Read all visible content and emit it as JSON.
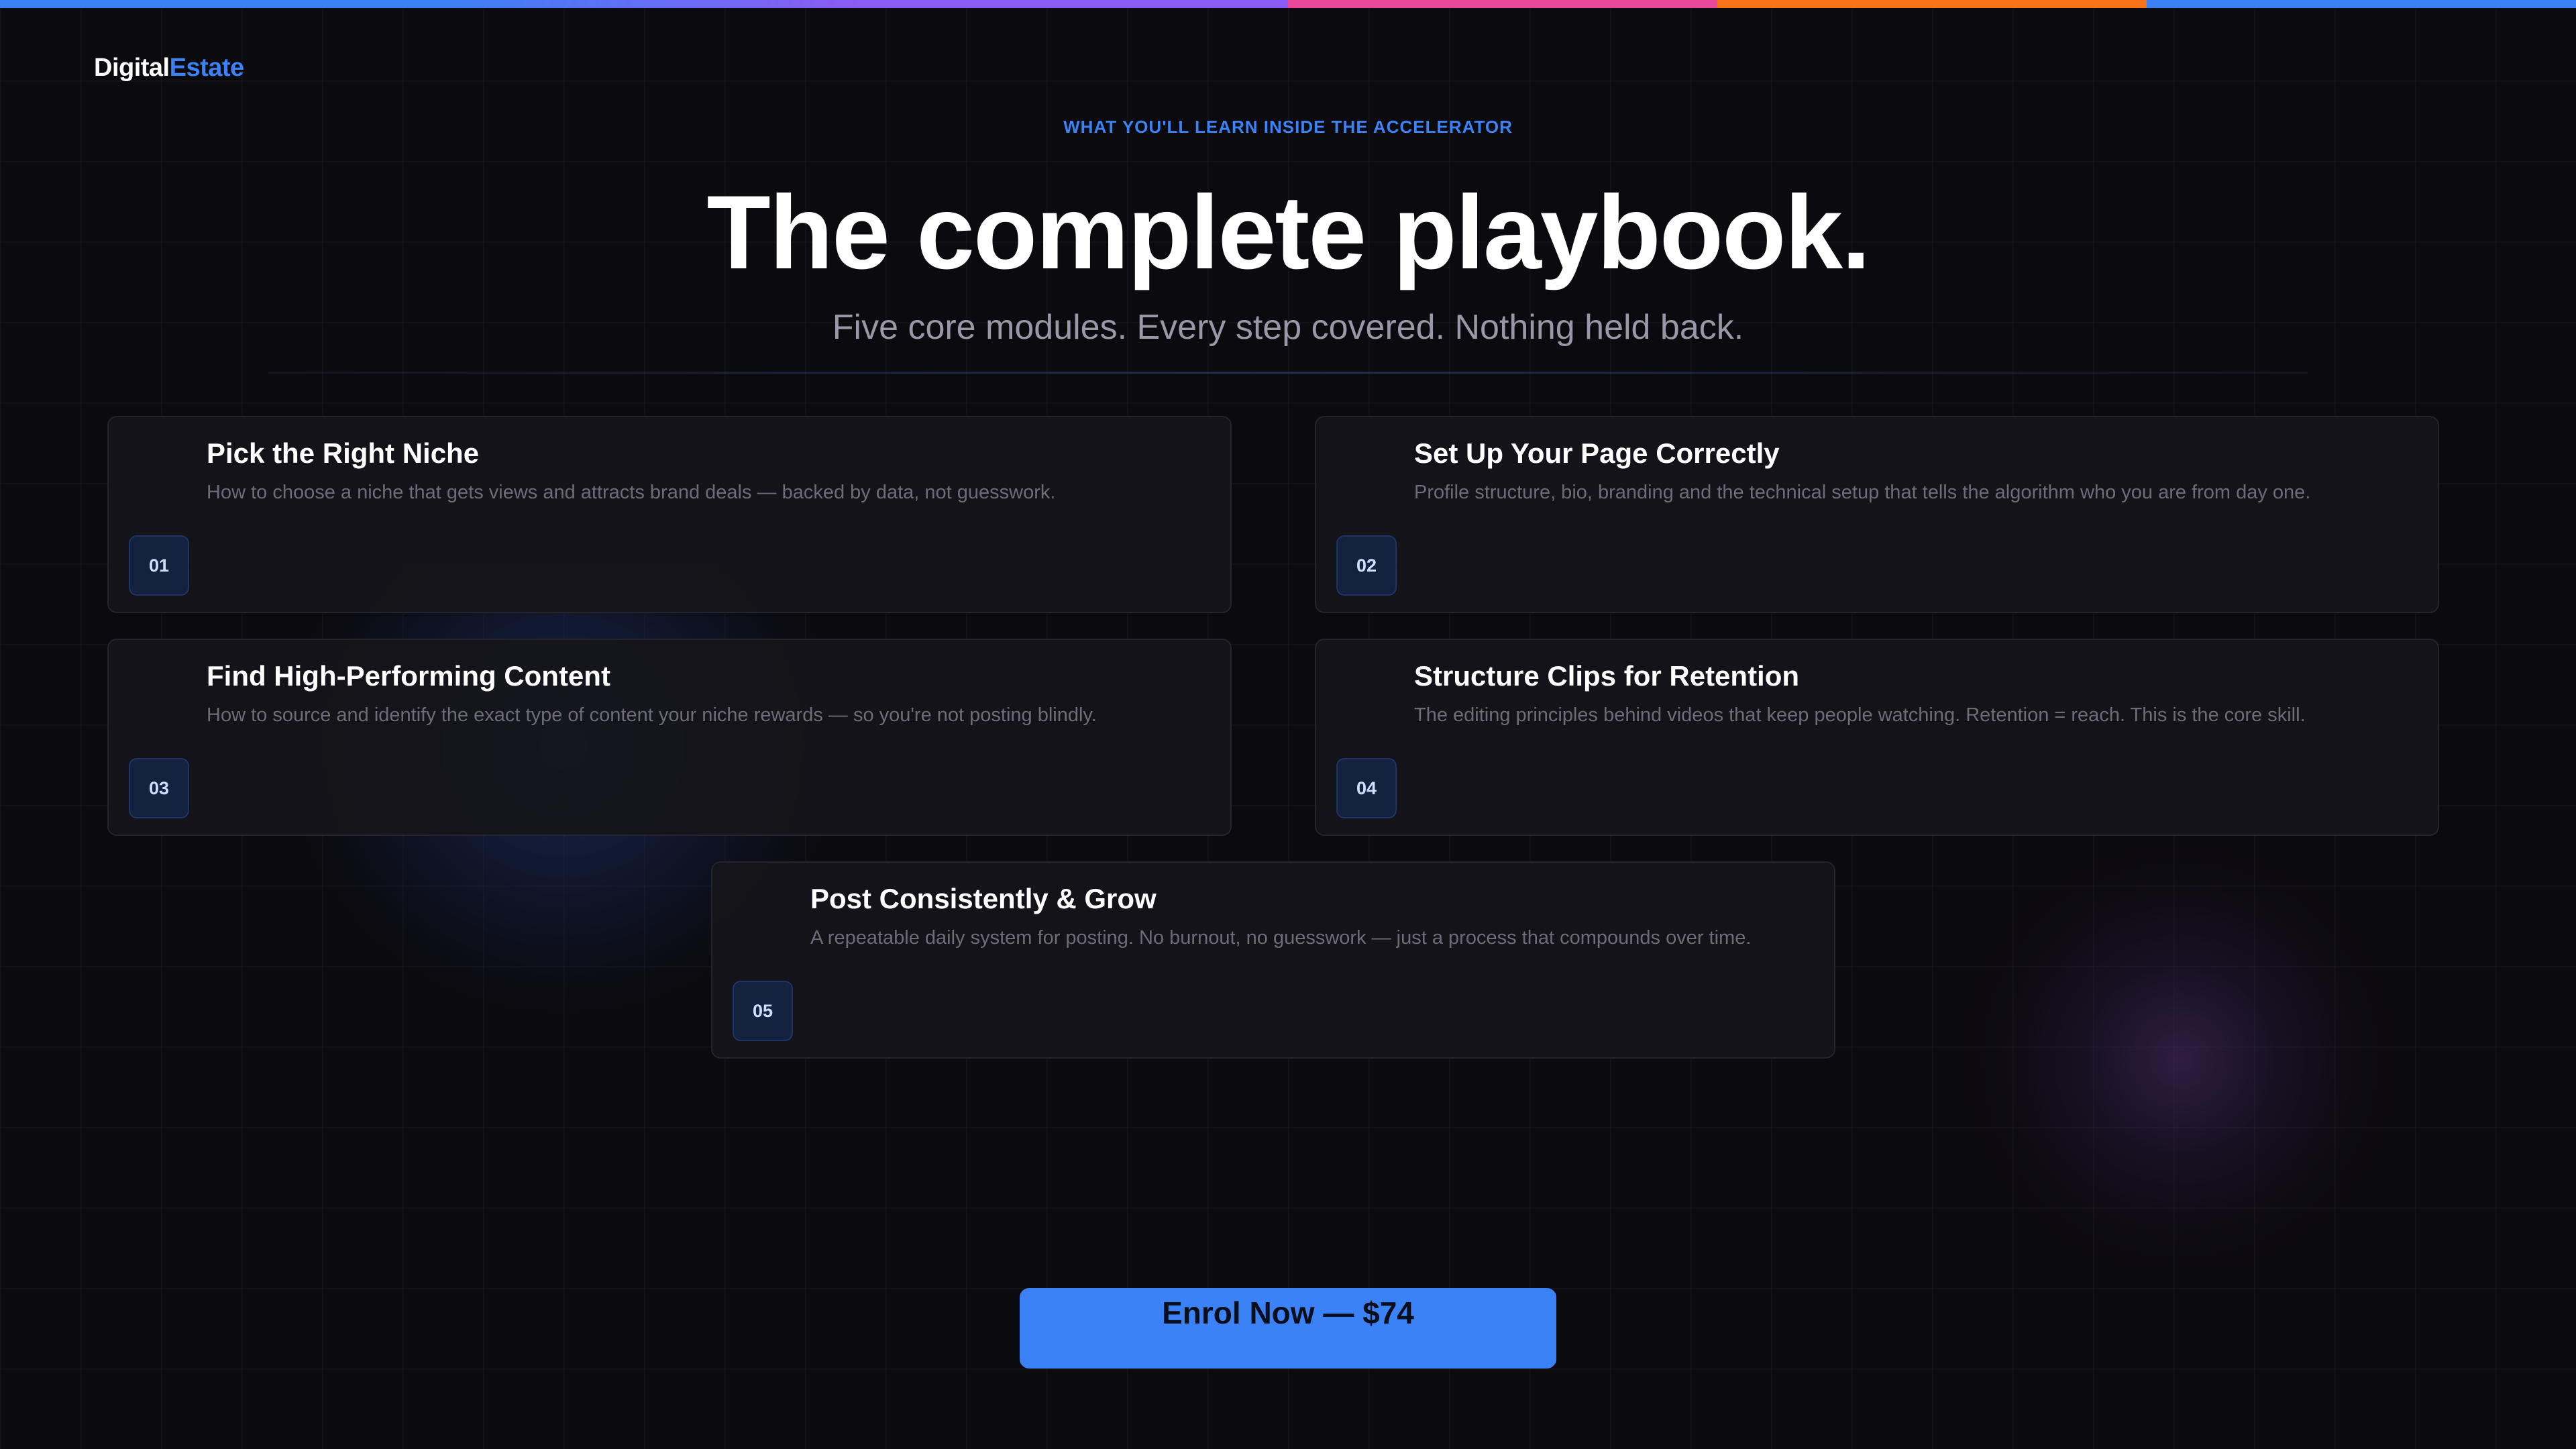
{
  "brand": {
    "logo_part1": "Digital",
    "logo_part2": "Estate",
    "logo_part1_color": "#ffffff",
    "logo_part2_color": "#3b82f6"
  },
  "topbar_colors": [
    "#3b82f6",
    "#8b5cf6",
    "#ec4899",
    "#f97316",
    "#3b82f6"
  ],
  "hero": {
    "eyebrow": "WHAT YOU'LL LEARN INSIDE THE ACCELERATOR",
    "title": "The complete playbook.",
    "subtitle": "Five core modules. Every step covered. Nothing held back."
  },
  "modules": [
    {
      "number": "01",
      "title": "Pick the Right Niche",
      "description": "How to choose a niche that gets views and attracts brand deals — backed by data, not guesswork."
    },
    {
      "number": "02",
      "title": "Set Up Your Page Correctly",
      "description": "Profile structure, bio, branding and the technical setup that tells the algorithm who you are from day one."
    },
    {
      "number": "03",
      "title": "Find High-Performing Content",
      "description": "How to source and identify the exact type of content your niche rewards — so you're not posting blindly."
    },
    {
      "number": "04",
      "title": "Structure Clips for Retention",
      "description": "The editing principles behind videos that keep people watching. Retention = reach. This is the core skill."
    },
    {
      "number": "05",
      "title": "Post Consistently & Grow",
      "description": "A repeatable daily system for posting. No burnout, no guesswork — just a process that compounds over time."
    }
  ],
  "cta": {
    "label": "Enrol Now — $74",
    "color": "#3b82f6"
  },
  "colors": {
    "background": "#0b0a0e",
    "accent": "#3b82f6",
    "card_bg": "#16151a",
    "badge_bg": "#14213f"
  }
}
